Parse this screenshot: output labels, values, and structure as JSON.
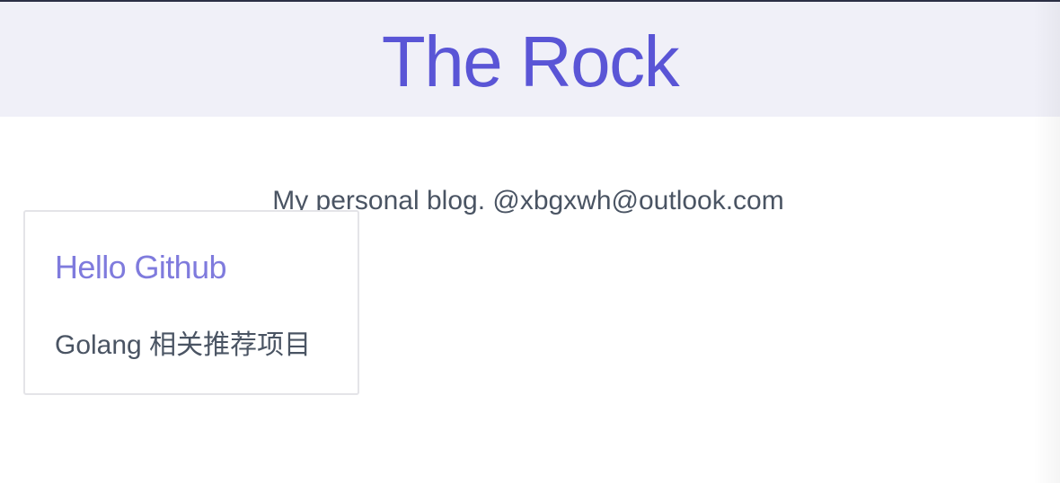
{
  "header": {
    "site_title": "The Rock"
  },
  "tagline": "My personal blog. @xbgxwh@outlook.com",
  "posts": [
    {
      "title": "Hello Github",
      "description": "Golang 相关推荐项目"
    }
  ],
  "colors": {
    "header_background": "#f0f0f8",
    "title_accent": "#5a55d6",
    "post_link": "#7f7bdd",
    "body_text": "#4a5463",
    "card_border": "#e4e4e8"
  }
}
